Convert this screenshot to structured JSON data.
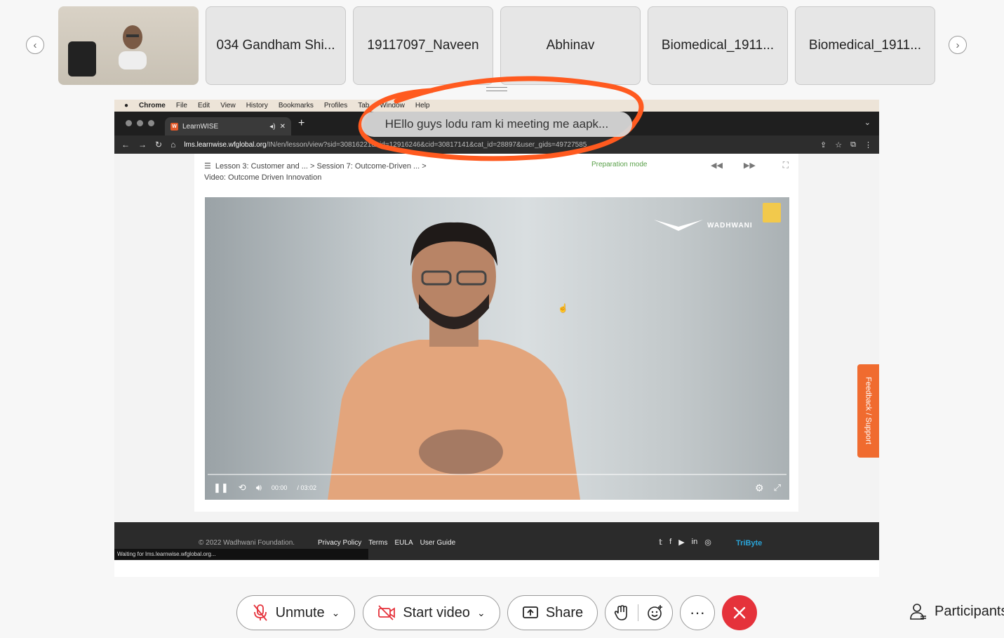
{
  "participants_strip": {
    "tiles": [
      {
        "label": ""
      },
      {
        "label": "034 Gandham Shi..."
      },
      {
        "label": "19117097_Naveen"
      },
      {
        "label": "Abhinav"
      },
      {
        "label": "Biomedical_1911..."
      },
      {
        "label": "Biomedical_1911..."
      }
    ]
  },
  "mac_menu": {
    "app": "Chrome",
    "items": [
      "File",
      "Edit",
      "View",
      "History",
      "Bookmarks",
      "Profiles",
      "Tab",
      "Window",
      "Help"
    ]
  },
  "browser": {
    "tab_title": "LearnWISE",
    "favicon_letter": "W",
    "url_host": "lms.learnwise.wfglobal.org",
    "url_path": "/IN/en/lesson/view?sid=30816221&vid=12916246&cid=30817141&cat_id=28897&user_gids=49727585"
  },
  "lesson": {
    "breadcrumb_1": "Lesson 3: Customer and ... > Session 7: Outcome-Driven ... >",
    "breadcrumb_2": "Video: Outcome Driven Innovation",
    "mode": "Preparation mode"
  },
  "video": {
    "logo_text": "WADHWANI",
    "current_time": "00:00",
    "duration": "/ 03:02",
    "progress": 0
  },
  "feedback_tab": "Feedback / Support",
  "footer": {
    "copyright": "© 2022 Wadhwani Foundation.",
    "links": [
      "Privacy Policy",
      "Terms",
      "EULA",
      "User Guide"
    ],
    "powered_by": "TriByte"
  },
  "status_text": "Waiting for lms.learnwise.wfglobal.org...",
  "chat_toast": "HEllo guys lodu ram ki meeting me aapk...",
  "controls": {
    "unmute": "Unmute",
    "start_video": "Start video",
    "share": "Share",
    "participants": "Participants"
  },
  "colors": {
    "end_call": "#e5323b",
    "annotation": "#ff5a1f",
    "feedback": "#f06b2f",
    "prep_mode": "#5aa04a"
  }
}
